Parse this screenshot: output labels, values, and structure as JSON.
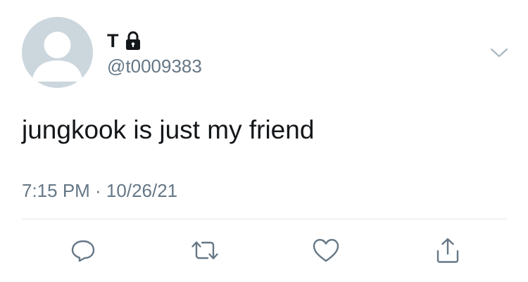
{
  "tweet": {
    "display_name": "T",
    "handle": "@t0009383",
    "text": "jungkook is just my friend",
    "timestamp": "7:15 PM · 10/26/21"
  },
  "icons": {
    "avatar": "default-avatar",
    "verified_lock": "lock-icon",
    "menu": "chevron-down-icon",
    "reply": "reply-icon",
    "retweet": "retweet-icon",
    "like": "heart-icon",
    "share": "share-icon"
  },
  "colors": {
    "text_primary": "#14171a",
    "text_secondary": "#657786",
    "avatar_bg": "#ccd6dd",
    "avatar_fg": "#ffffff",
    "divider": "#e1e8ed"
  }
}
